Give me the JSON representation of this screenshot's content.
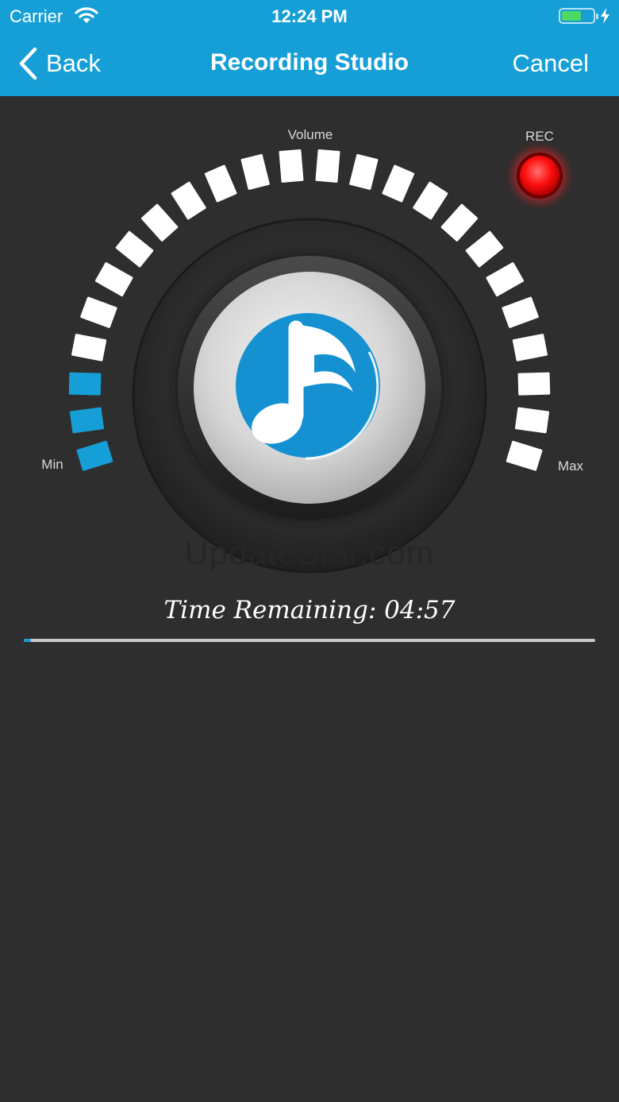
{
  "status_bar": {
    "carrier": "Carrier",
    "time": "12:24 PM"
  },
  "nav": {
    "back_label": "Back",
    "title": "Recording Studio",
    "cancel_label": "Cancel"
  },
  "dial": {
    "volume_label": "Volume",
    "min_label": "Min",
    "max_label": "Max",
    "rec_label": "REC",
    "level_active_segments": 3,
    "level_total_segments": 24
  },
  "watermark": "UpdateStar.com",
  "time_remaining": "Time Remaining: 04:57",
  "progress": 0.012,
  "colors": {
    "accent": "#169fd6",
    "background": "#2e2e2f",
    "rec": "#ff1a1a",
    "segment": "#ffffff"
  }
}
